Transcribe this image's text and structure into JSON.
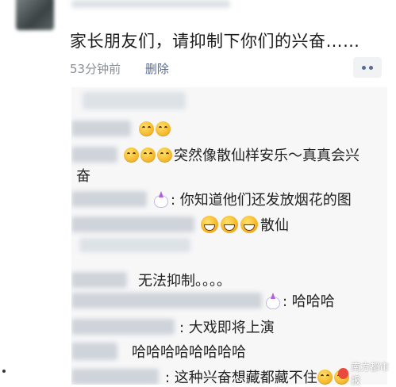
{
  "post": {
    "text": "家长朋友们，请抑制下你们的兴奋……",
    "time": "53分钟前",
    "delete_label": "删除"
  },
  "icons": {
    "avatar": "avatar-image",
    "more": "more-dots-icon",
    "emoji_laugh": "laughing-emoji-icon",
    "emoji_grin": "grinning-emoji-icon",
    "emoji_unicorn": "unicorn-emoji-icon"
  },
  "screenshot": {
    "rows": [
      {
        "text": ""
      },
      {
        "text": ""
      },
      {
        "text": "突然像散仙样安乐～真真会兴"
      },
      {
        "text": "奋"
      },
      {
        "text": ": 你知道他们还发放烟花的图"
      },
      {
        "text": "散仙"
      },
      {
        "text": "无法抑制。。。。"
      },
      {
        "text": ": 哈哈哈"
      },
      {
        "text": ": 大戏即将上演"
      },
      {
        "text": "哈哈哈哈哈哈哈哈"
      },
      {
        "text": ": 这种兴奋想藏都藏不住"
      }
    ]
  },
  "watermark": {
    "text": "南方都市报"
  },
  "colors": {
    "link": "#576b95",
    "meta": "#8a8f95",
    "screenshot_bg": "#f7f7f8"
  }
}
